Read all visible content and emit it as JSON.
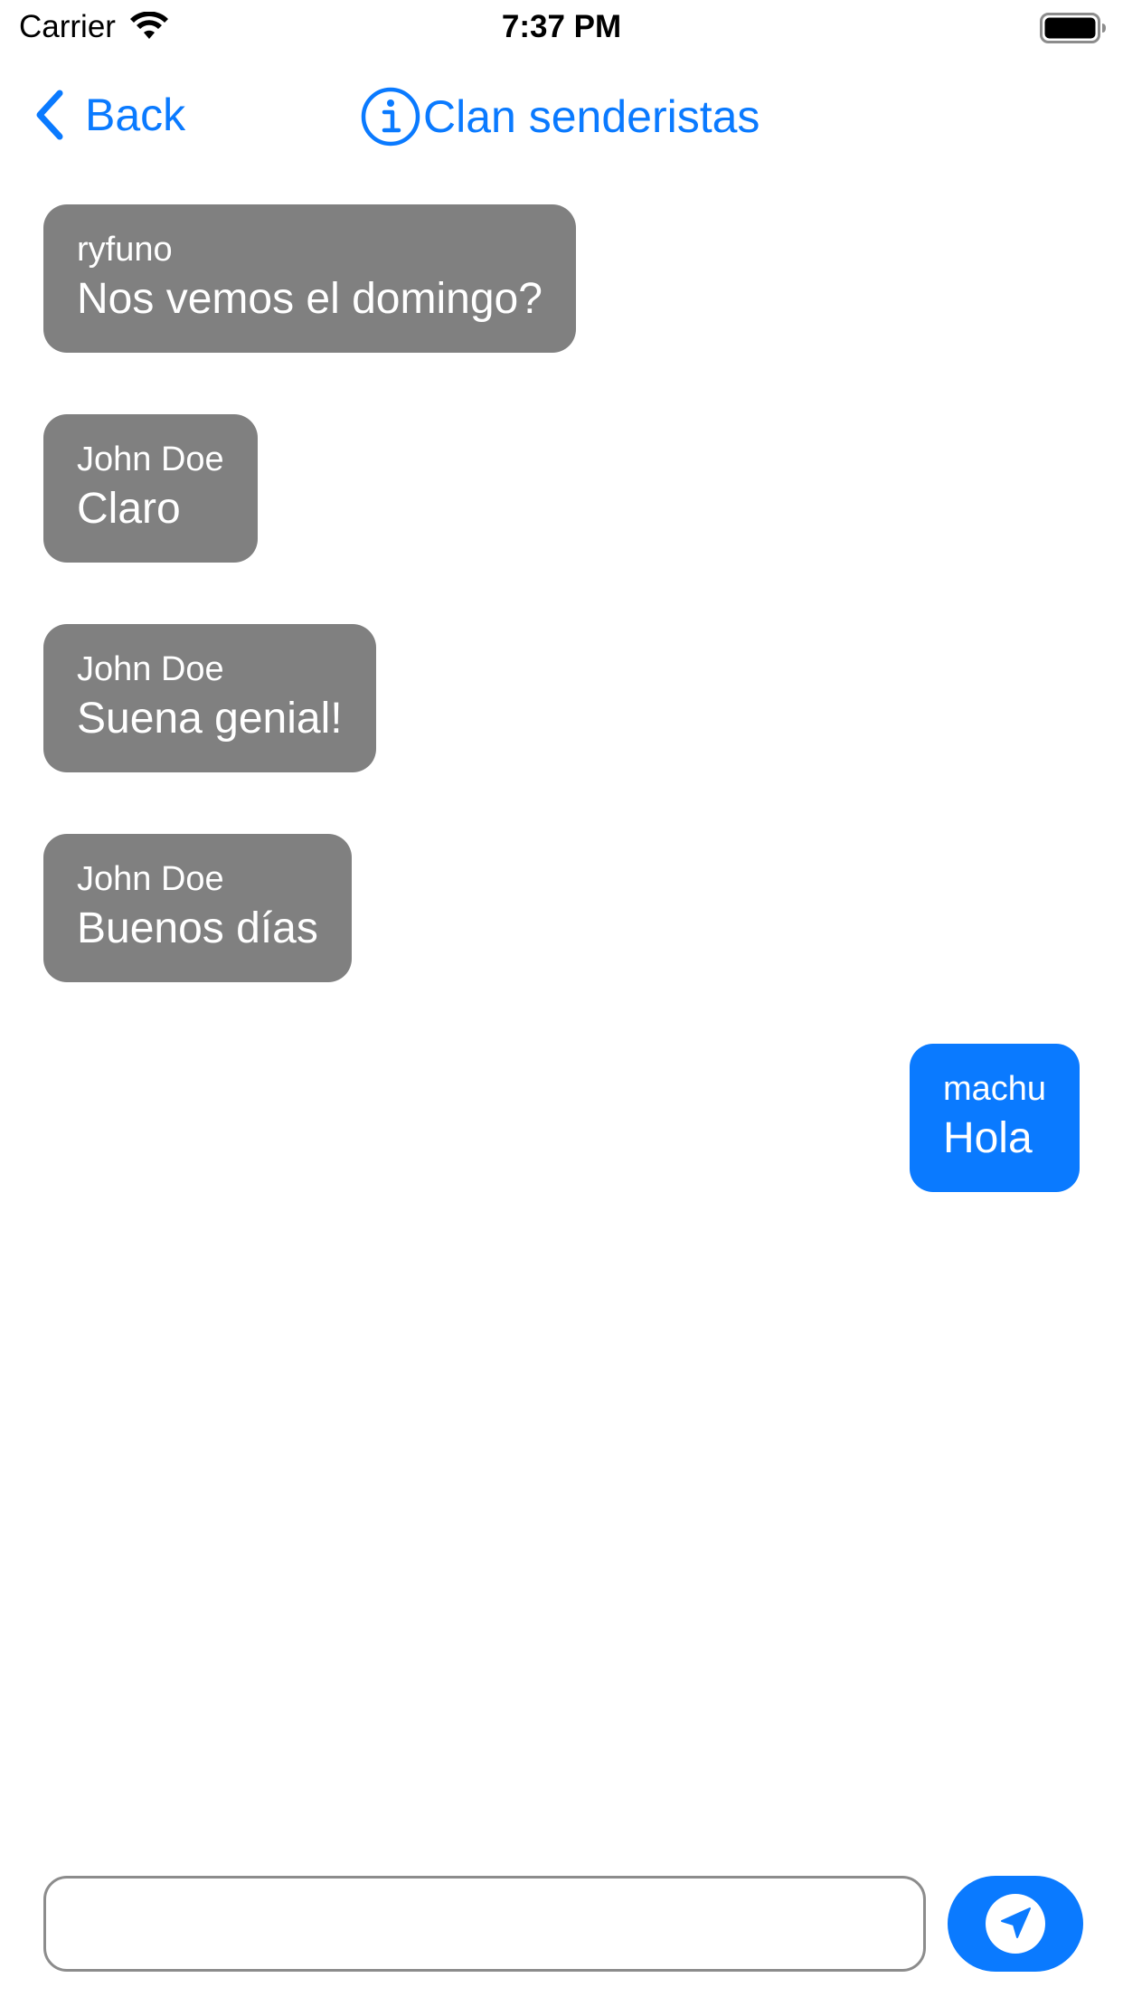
{
  "status_bar": {
    "carrier": "Carrier",
    "time": "7:37 PM",
    "icons": [
      "wifi-icon",
      "battery-icon"
    ]
  },
  "nav": {
    "back_label": "Back",
    "title": "Clan senderistas",
    "icons": [
      "chevron-left-icon",
      "info-icon"
    ]
  },
  "messages": [
    {
      "sender": "ryfuno",
      "text": "Nos vemos el domingo?",
      "direction": "incoming"
    },
    {
      "sender": "John Doe",
      "text": "Claro",
      "direction": "incoming"
    },
    {
      "sender": "John Doe",
      "text": "Suena genial!",
      "direction": "incoming"
    },
    {
      "sender": "John Doe",
      "text": "Buenos días",
      "direction": "incoming"
    },
    {
      "sender": "machu",
      "text": "Hola",
      "direction": "outgoing"
    }
  ],
  "composer": {
    "value": "",
    "placeholder": "",
    "send_icon": "send-icon"
  },
  "colors": {
    "accent": "#0a7aff",
    "incoming_bubble": "#808080",
    "outgoing_bubble": "#0a7aff",
    "bubble_text": "#ffffff"
  }
}
